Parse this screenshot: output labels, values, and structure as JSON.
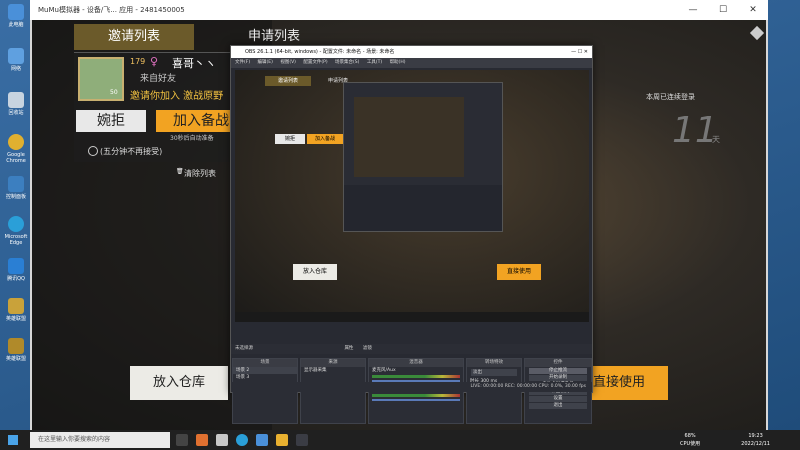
{
  "desktop": {
    "icons": [
      {
        "label": "此电脑",
        "color": "#4a90d9"
      },
      {
        "label": "网络",
        "color": "#5fa0e0"
      },
      {
        "label": "回收站",
        "color": "#c8d4e0"
      },
      {
        "label": "Google Chrome",
        "color": "#e0b030"
      },
      {
        "label": "控制面板",
        "color": "#3c7fc0"
      },
      {
        "label": "Microsoft Edge",
        "color": "#2a9fd8"
      },
      {
        "label": "腾讯QQ",
        "color": "#2a7fd4"
      },
      {
        "label": "英雄联盟",
        "color": "#c9a23a"
      },
      {
        "label": "英雄联盟",
        "color": "#b08a2a"
      }
    ]
  },
  "emulator": {
    "title": "MuMu模拟器 - 设备/飞... 应用 - 2481450005",
    "controls": [
      "—",
      "☐",
      "✕"
    ]
  },
  "game": {
    "tab_invite": "邀请列表",
    "tab_apply": "申请列表",
    "player_level": "179",
    "player_name": "喜哥丶ヽ",
    "from_friend": "来自好友",
    "level_badge": "50",
    "invite_text": "邀请你加入 激战原野",
    "refuse_btn": "婉拒",
    "join_btn": "加入备战",
    "countdown": "30秒后自动准备",
    "no_accept_label": "(五分钟不再接受)",
    "clear_list": "清除列表",
    "put_warehouse": "放入仓库",
    "use_direct": "直接使用",
    "streak_text": "本周已连续登录",
    "streak_number": "11",
    "streak_unit": "天"
  },
  "obs": {
    "title": "OBS 26.1.1 (64-bit, windows) - 配置文件: 未命名 - 场景: 未命名",
    "menu": [
      "文件(F)",
      "编辑(E)",
      "视图(V)",
      "配置文件(P)",
      "场景集合(S)",
      "工具(T)",
      "帮助(H)"
    ],
    "source_bar": "未选择源",
    "source_props": "属性",
    "source_filters": "滤镜",
    "panel_scenes": "场景",
    "scenes": [
      "场景 2",
      "场景 3"
    ],
    "panel_sources": "来源",
    "sources": [
      "显示器采集"
    ],
    "panel_mixer": "混音器",
    "mixer": [
      {
        "name": "麦克风/Aux",
        "db": "0.0 dB"
      },
      {
        "name": "桌面音频",
        "db": "0.0 dB"
      }
    ],
    "panel_transition": "转场特效",
    "transition_type": "淡出",
    "duration_label": "时长",
    "duration_value": "300 ms",
    "panel_controls": "控件",
    "controls": [
      "停止推流",
      "开始录制",
      "启动虚拟摄像机",
      "工作室模式",
      "设置",
      "退出"
    ],
    "status": "LIVE: 00:00:00   REC: 00:00:00   CPU: 0.0%, 30.00 fps"
  },
  "taskbar": {
    "search_placeholder": "在这里输入你要搜索的内容",
    "cpu": "68%",
    "cpu_label": "CPU使用",
    "time": "19:23",
    "date": "2022/12/11"
  }
}
